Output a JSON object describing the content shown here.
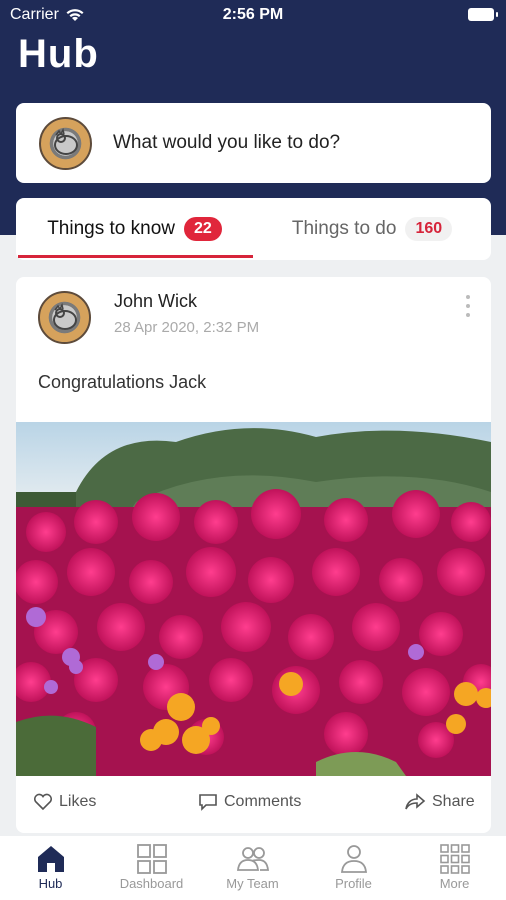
{
  "status": {
    "carrier": "Carrier",
    "time": "2:56 PM"
  },
  "header": {
    "title": "Hub"
  },
  "ask": {
    "prompt": "What would you like to do?"
  },
  "tabs": [
    {
      "label": "Things to know",
      "count": "22",
      "active": true
    },
    {
      "label": "Things to do",
      "count": "160",
      "active": false
    }
  ],
  "post": {
    "author": "John Wick",
    "timestamp": "28 Apr 2020, 2:32 PM",
    "message": "Congratulations Jack",
    "image": "flower-field-photo",
    "actions": {
      "likes": "Likes",
      "comments": "Comments",
      "share": "Share"
    }
  },
  "nav": [
    {
      "label": "Hub",
      "icon": "home-icon",
      "active": true
    },
    {
      "label": "Dashboard",
      "icon": "dashboard-icon",
      "active": false
    },
    {
      "label": "My Team",
      "icon": "team-icon",
      "active": false
    },
    {
      "label": "Profile",
      "icon": "profile-icon",
      "active": false
    },
    {
      "label": "More",
      "icon": "grid-icon",
      "active": false
    }
  ],
  "colors": {
    "brand_navy": "#1f2b57",
    "accent_red": "#e0263b",
    "background": "#eef0f2"
  }
}
